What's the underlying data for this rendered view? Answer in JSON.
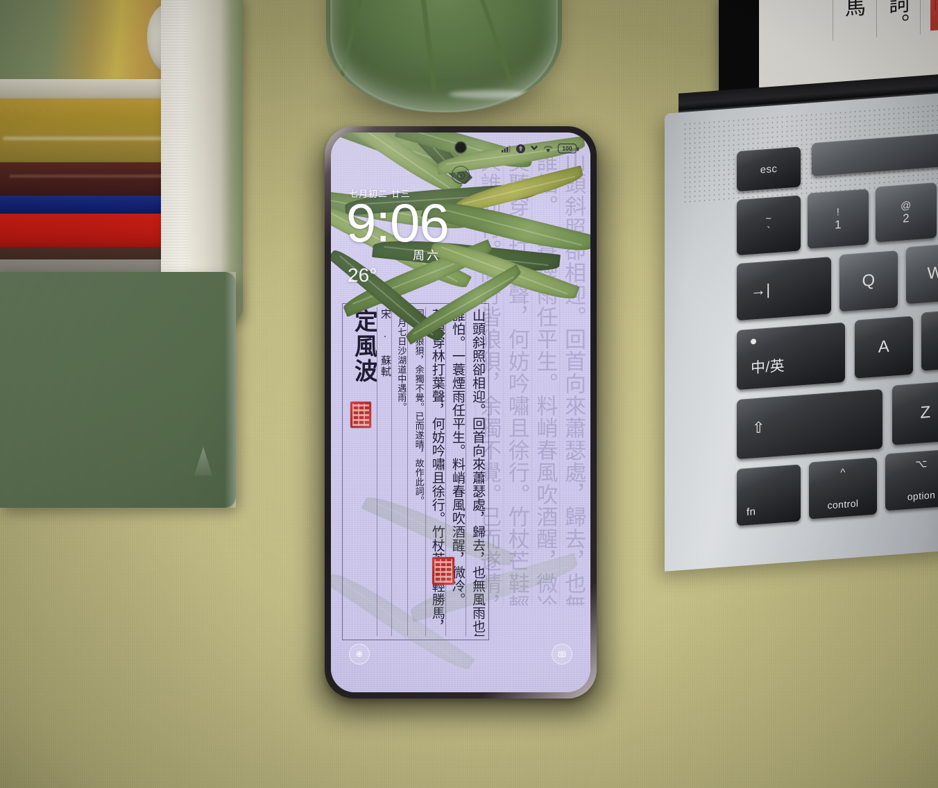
{
  "scene": {
    "description": "Smartphone lock screen on a desk with books, a glass vase of bamboo, and a laptop",
    "desk_color": "#c8c288"
  },
  "phone": {
    "status_bar": {
      "icons": [
        "signal-bars-icon",
        "wifi-icon",
        "mobile-data-icon",
        "vpn-icon"
      ],
      "battery_label": "100"
    },
    "lock_screen": {
      "alarm_icon": "alarm-clock-icon",
      "lunar_date": "七月初二 廿三",
      "time": "9:06",
      "weekday": "周六",
      "temperature": "26°",
      "shortcuts": {
        "left": "flashlight-icon",
        "right": "camera-icon"
      }
    },
    "wallpaper": {
      "poem": {
        "title": "定風波",
        "byline": "宋 · 蘇軾",
        "preface": "三月七日沙湖道中遇雨。",
        "preface2": "同行皆狼狽，余獨不覺。已而遂晴，故作此詞。",
        "columns": [
          "山頭斜照卻相迎。回首向來蕭瑟處，歸去，也無風雨也無晴。",
          "誰怕。一蓑煙雨任平生。料峭春風吹酒醒，微冷。",
          "莫聽穿林打葉聲，何妨吟嘯且徐行。竹杖芒鞋輕勝馬，",
          "與誰同行。同行皆狼狽，余獨不覺。已而遂晴，故作此詞。"
        ],
        "seals": [
          "red-seal-stamp",
          "red-seal-stamp"
        ]
      },
      "overlay": "bamboo-leaves"
    }
  },
  "laptop": {
    "screen_content": "中遇雨。 作此詞。 輕勝馬",
    "keys": [
      {
        "label": "esc",
        "name": "key-esc"
      },
      {
        "label": "~",
        "sub": "`",
        "name": "key-tilde"
      },
      {
        "label": "!",
        "sub": "1",
        "name": "key-1"
      },
      {
        "label": "@",
        "sub": "2",
        "name": "key-2"
      },
      {
        "label": "→|",
        "name": "key-tab"
      },
      {
        "label": "Q",
        "name": "key-q"
      },
      {
        "label": "W",
        "name": "key-w"
      },
      {
        "label": "中/英",
        "name": "key-input-toggle"
      },
      {
        "label": "A",
        "name": "key-a"
      },
      {
        "label": "⇧",
        "name": "key-shift"
      },
      {
        "label": "Z",
        "name": "key-z"
      },
      {
        "label": "fn",
        "name": "key-fn"
      },
      {
        "label": "control",
        "sub": "^",
        "name": "key-control"
      },
      {
        "label": "option",
        "sub": "⌥",
        "name": "key-option"
      }
    ]
  },
  "books": {
    "items": [
      {
        "name": "book-top-green-yellow"
      },
      {
        "name": "book-olive"
      },
      {
        "name": "book-dark-red"
      },
      {
        "name": "book-blue"
      },
      {
        "name": "book-red"
      },
      {
        "name": "book-brown"
      },
      {
        "name": "notebook-green"
      }
    ]
  },
  "vase": {
    "name": "glass-vase-with-bamboo"
  }
}
